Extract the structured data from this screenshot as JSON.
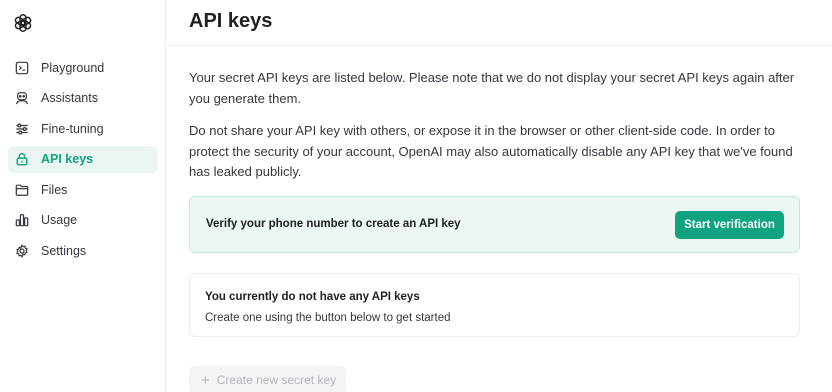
{
  "sidebar": {
    "logo_icon": "openai-logo-icon",
    "items": [
      {
        "label": "Playground",
        "icon": "terminal-icon",
        "active": false
      },
      {
        "label": "Assistants",
        "icon": "robot-icon",
        "active": false
      },
      {
        "label": "Fine-tuning",
        "icon": "sliders-icon",
        "active": false
      },
      {
        "label": "API keys",
        "icon": "lock-icon",
        "active": true
      },
      {
        "label": "Files",
        "icon": "folder-icon",
        "active": false
      },
      {
        "label": "Usage",
        "icon": "bar-chart-icon",
        "active": false
      },
      {
        "label": "Settings",
        "icon": "gear-icon",
        "active": false
      }
    ]
  },
  "header": {
    "title": "API keys"
  },
  "main": {
    "intro": "Your secret API keys are listed below. Please note that we do not display your secret API keys again after you generate them.",
    "warning": "Do not share your API key with others, or expose it in the browser or other client-side code. In order to protect the security of your account, OpenAI may also automatically disable any API key that we've found has leaked publicly.",
    "verify": {
      "text": "Verify your phone number to create an API key",
      "button_label": "Start verification"
    },
    "empty_state": {
      "title": "You currently do not have any API keys",
      "subtitle": "Create one using the button below to get started"
    },
    "create_button": {
      "label": "Create new secret key",
      "icon": "plus-icon",
      "disabled": true
    }
  },
  "colors": {
    "accent": "#10a37f",
    "active_bg": "#ebf6f3",
    "verify_bg": "#ebf7f0",
    "disabled_text": "#b4b4be"
  }
}
